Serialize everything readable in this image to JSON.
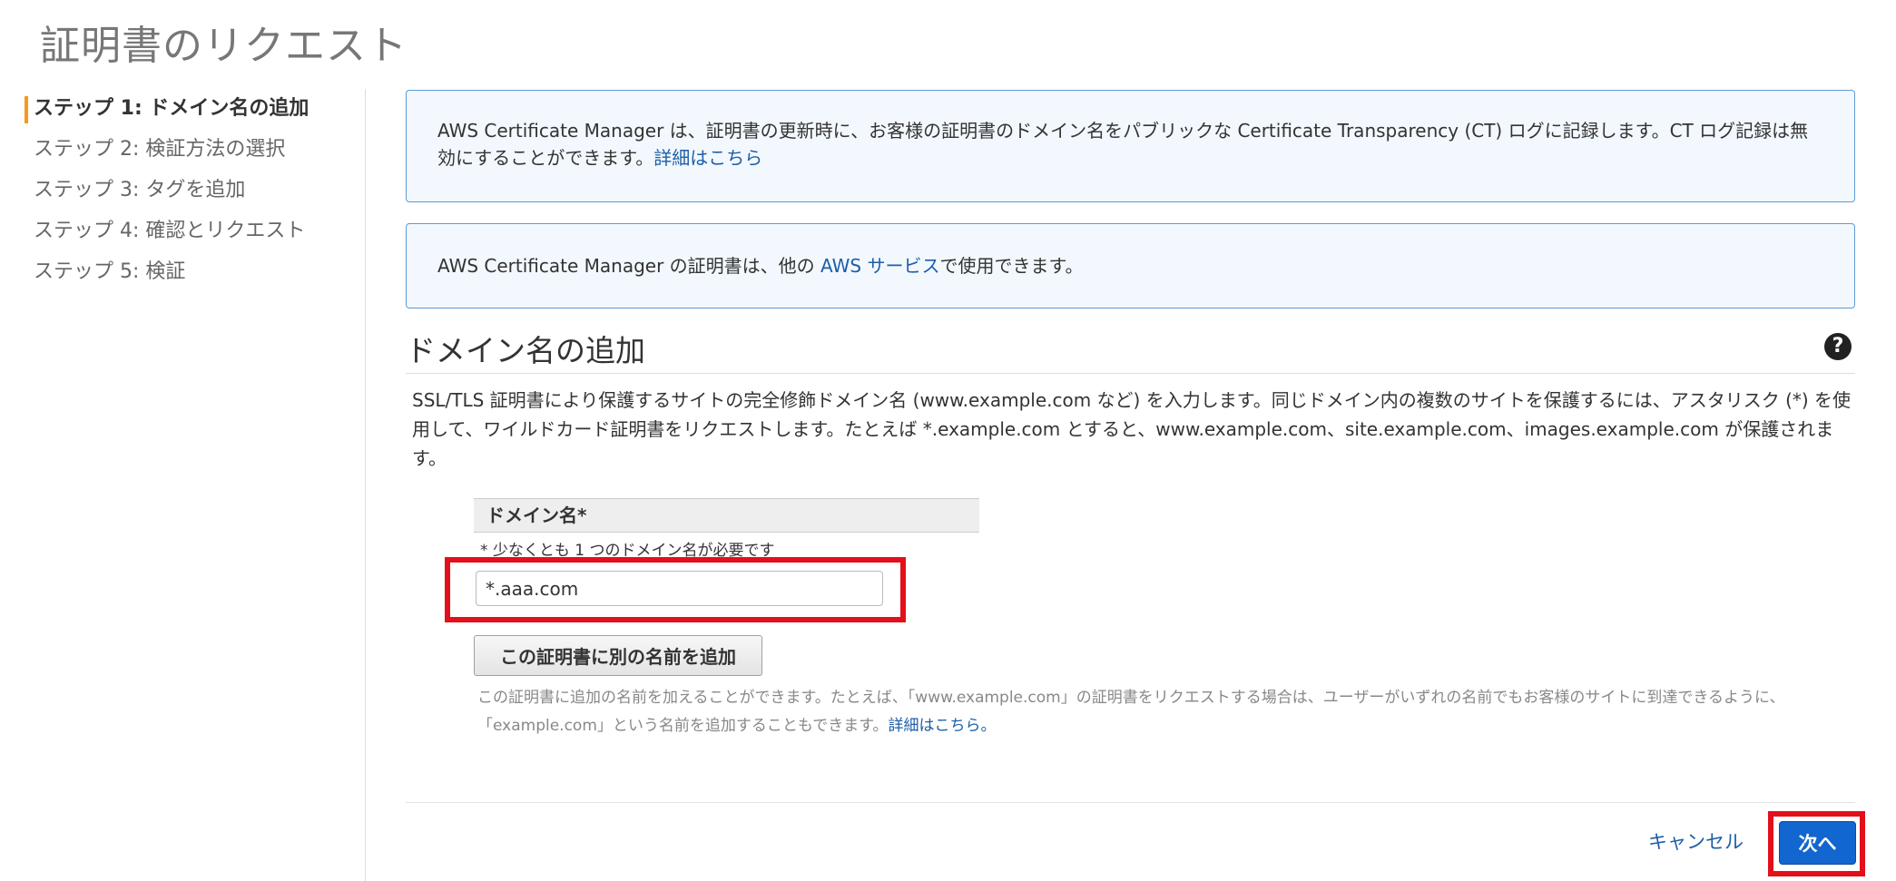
{
  "page": {
    "title": "証明書のリクエスト"
  },
  "steps": [
    {
      "label": "ステップ 1: ドメイン名の追加",
      "active": true
    },
    {
      "label": "ステップ 2: 検証方法の選択",
      "active": false
    },
    {
      "label": "ステップ 3: タグを追加",
      "active": false
    },
    {
      "label": "ステップ 4: 確認とリクエスト",
      "active": false
    },
    {
      "label": "ステップ 5: 検証",
      "active": false
    }
  ],
  "info_ct": {
    "text": "AWS Certificate Manager は、証明書の更新時に、お客様の証明書のドメイン名をパブリックな Certificate Transparency (CT) ログに記録します。CT ログ記録は無効にすることができます。",
    "link": "詳細はこちら"
  },
  "info_aws": {
    "prefix": "AWS Certificate Manager の証明書は、他の ",
    "link": "AWS サービス",
    "suffix": "で使用できます。"
  },
  "section": {
    "title": "ドメイン名の追加",
    "help_icon": "question-circle-icon",
    "description": "SSL/TLS 証明書により保護するサイトの完全修飾ドメイン名 (www.example.com など) を入力します。同じドメイン内の複数のサイトを保護するには、アスタリスク (*) を使用して、ワイルドカード証明書をリクエストします。たとえば *.example.com とすると、www.example.com、site.example.com、images.example.com が保護されます。"
  },
  "domain": {
    "header": "ドメイン名*",
    "hint": "* 少なくとも 1 つのドメイン名が必要です",
    "value": "*.aaa.com"
  },
  "add_name": {
    "button_label": "この証明書に別の名前を追加",
    "help": "この証明書に追加の名前を加えることができます。たとえば、「www.example.com」の証明書をリクエストする場合は、ユーザーがいずれの名前でもお客様のサイトに到達できるように、「example.com」という名前を追加することもできます。",
    "help_link": "詳細はこちら。"
  },
  "footer": {
    "cancel_label": "キャンセル",
    "next_label": "次へ"
  },
  "colors": {
    "accent_step": "#f7981d",
    "info_border": "#5b9bd5",
    "info_bg": "#f2f8fd",
    "link": "#1d5ea8",
    "primary_button": "#1266d0",
    "highlight": "#e3101b"
  }
}
